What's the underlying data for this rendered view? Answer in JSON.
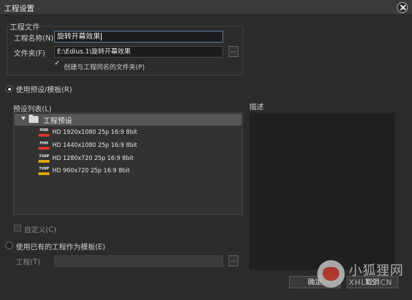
{
  "window": {
    "title": "工程设置"
  },
  "project_file": {
    "section_label": "工程文件",
    "name_label": "工程名称(N)",
    "name_value": "旋转开幕效果",
    "folder_label": "文件夹(F)",
    "folder_value": "E:\\Edius.1\\旋转开幕效果",
    "browse_label": "...",
    "create_folder_label": "创建与工程同名的文件夹(P)",
    "create_folder_checked": true
  },
  "preset_mode": {
    "use_preset_label": "使用预设/模板(R)",
    "preset_list_label": "预设列表(L)",
    "folder_name": "工程预设",
    "presets": [
      {
        "badge": "FHD",
        "badge_color": "#d9342b",
        "label": "HD 1920x1080 25p 16:9 8bit"
      },
      {
        "badge": "FHD",
        "badge_color": "#d9342b",
        "label": "HD 1440x1080 25p 16:9 8bit"
      },
      {
        "badge": "720P",
        "badge_color": "#e0a800",
        "label": "HD 1280x720 25p 16:9 8bit"
      },
      {
        "badge": "720P",
        "badge_color": "#e0a800",
        "label": "HD 960x720 25p 16:9 8bit"
      }
    ],
    "description_label": "描述",
    "custom_label": "自定义(C)"
  },
  "template_mode": {
    "use_existing_label": "使用已有的工程作为模板(E)",
    "project_label": "工程(T)",
    "project_value": "",
    "browse_label": "..."
  },
  "buttons": {
    "ok": "确定",
    "cancel": "取消"
  },
  "watermark": {
    "main": "小狐狸网",
    "sub": "XHLKS.CN"
  }
}
